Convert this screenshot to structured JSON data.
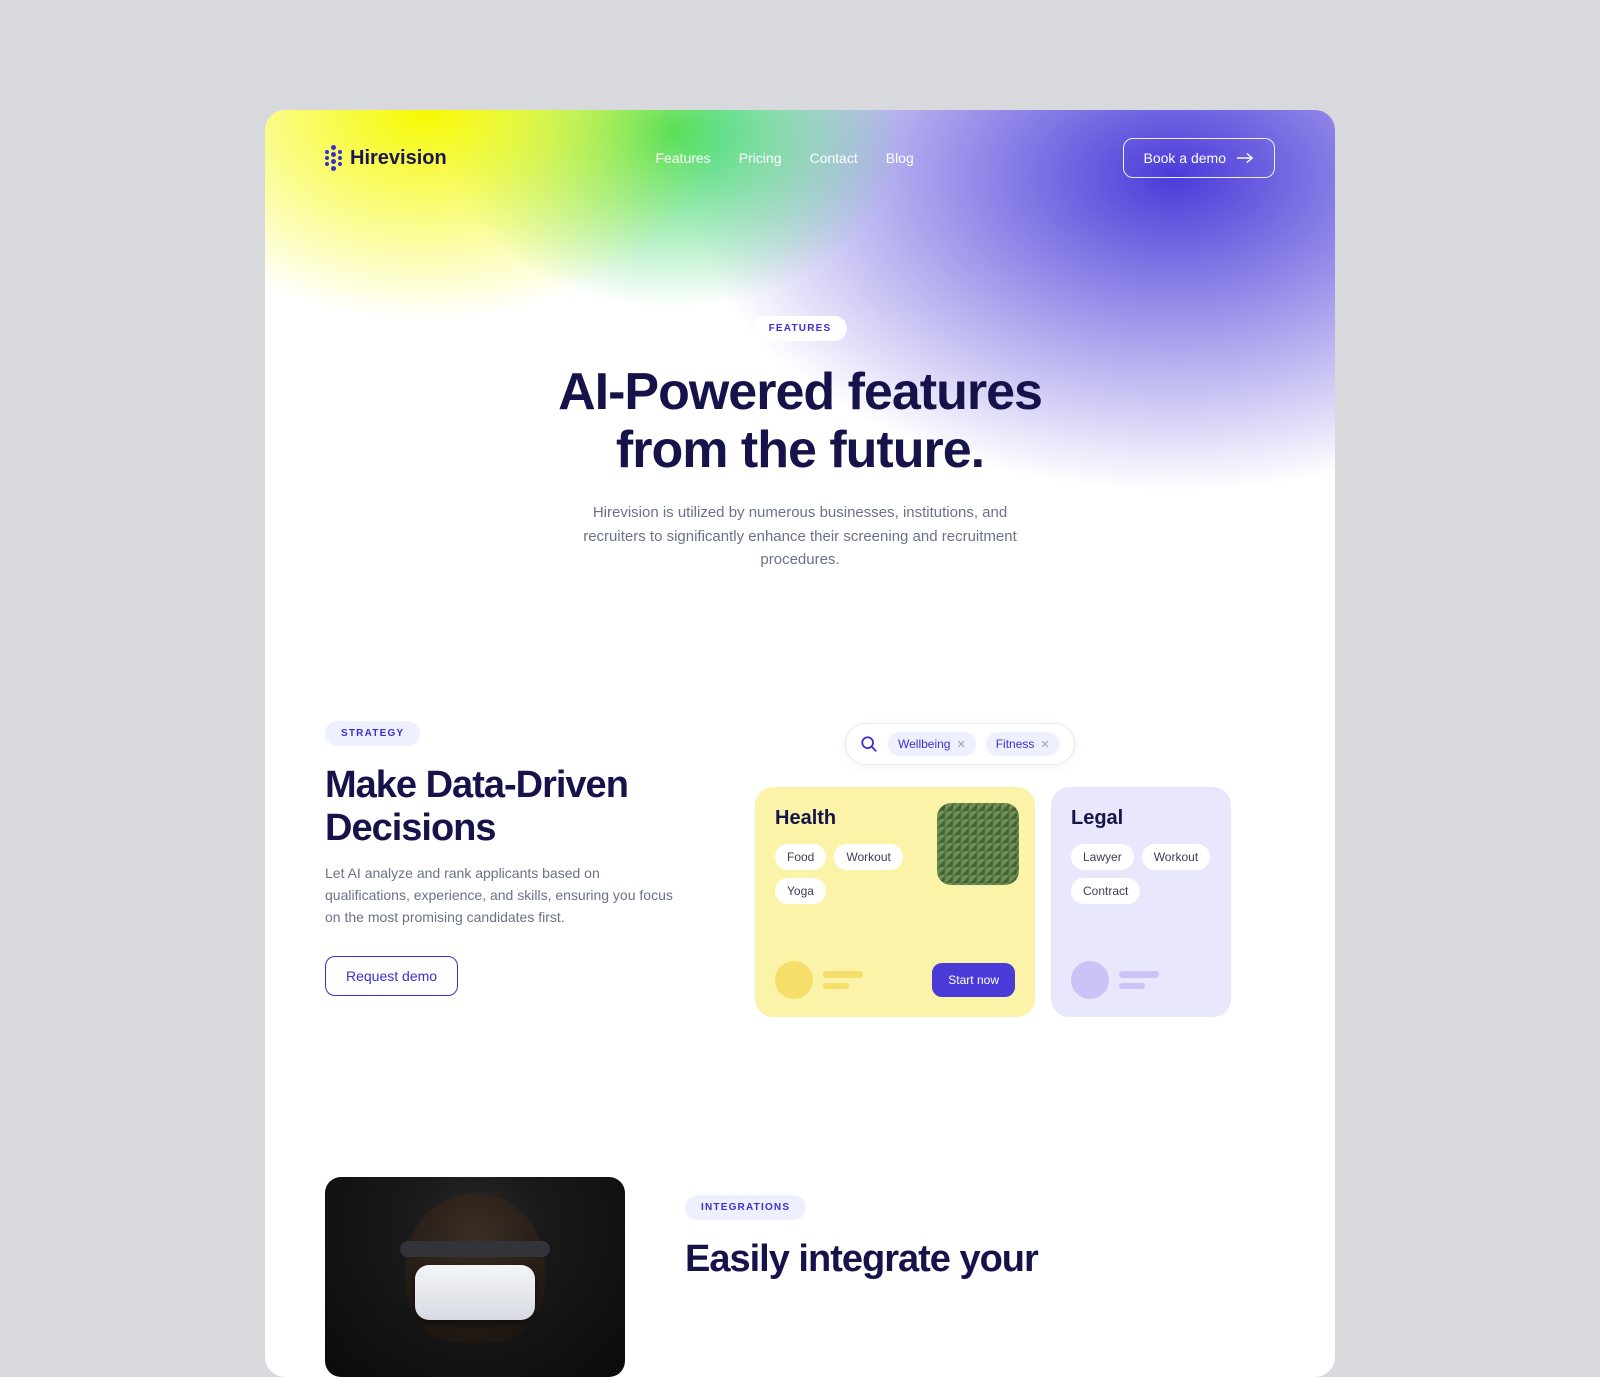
{
  "brand": "Hirevision",
  "nav": {
    "items": [
      "Features",
      "Pricing",
      "Contact",
      "Blog"
    ]
  },
  "cta": "Book a demo",
  "hero": {
    "pill": "FEATURES",
    "title_l1": "AI-Powered features",
    "title_l2": "from the future.",
    "subtitle": "Hirevision is utilized by numerous businesses, institutions, and recruiters to significantly enhance their screening and recruitment procedures."
  },
  "feature1": {
    "pill": "STRATEGY",
    "title": "Make Data-Driven Decisions",
    "body": "Let AI analyze and rank applicants based on qualifications, experience, and skills, ensuring you focus on the most promising candidates first.",
    "button": "Request demo"
  },
  "search": {
    "tags": [
      "Wellbeing",
      "Fitness"
    ]
  },
  "cards": {
    "health": {
      "title": "Health",
      "chips": [
        "Food",
        "Workout",
        "Yoga"
      ],
      "cta": "Start now"
    },
    "legal": {
      "title": "Legal",
      "chips": [
        "Lawyer",
        "Workout",
        "Contract"
      ]
    }
  },
  "feature2": {
    "pill": "INTEGRATIONS",
    "title": "Easily integrate your"
  }
}
